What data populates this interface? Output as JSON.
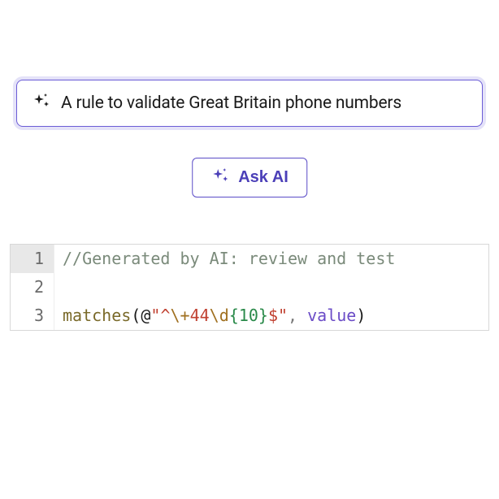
{
  "input": {
    "value": "A rule to validate Great Britain phone numbers"
  },
  "button": {
    "label": "Ask AI"
  },
  "code": {
    "lines": [
      "1",
      "2",
      "3"
    ],
    "line1": {
      "comment": "//Generated by AI: review and test"
    },
    "line3": {
      "func": "matches",
      "open": "(",
      "at": "@",
      "q1": "\"",
      "s1": "^",
      "esc1": "\\+",
      "s2": "44",
      "esc2": "\\d",
      "brace_open": "{",
      "num": "10",
      "brace_close": "}",
      "s3": "$",
      "q2": "\"",
      "comma": ", ",
      "ident": "value",
      "close": ")"
    }
  }
}
